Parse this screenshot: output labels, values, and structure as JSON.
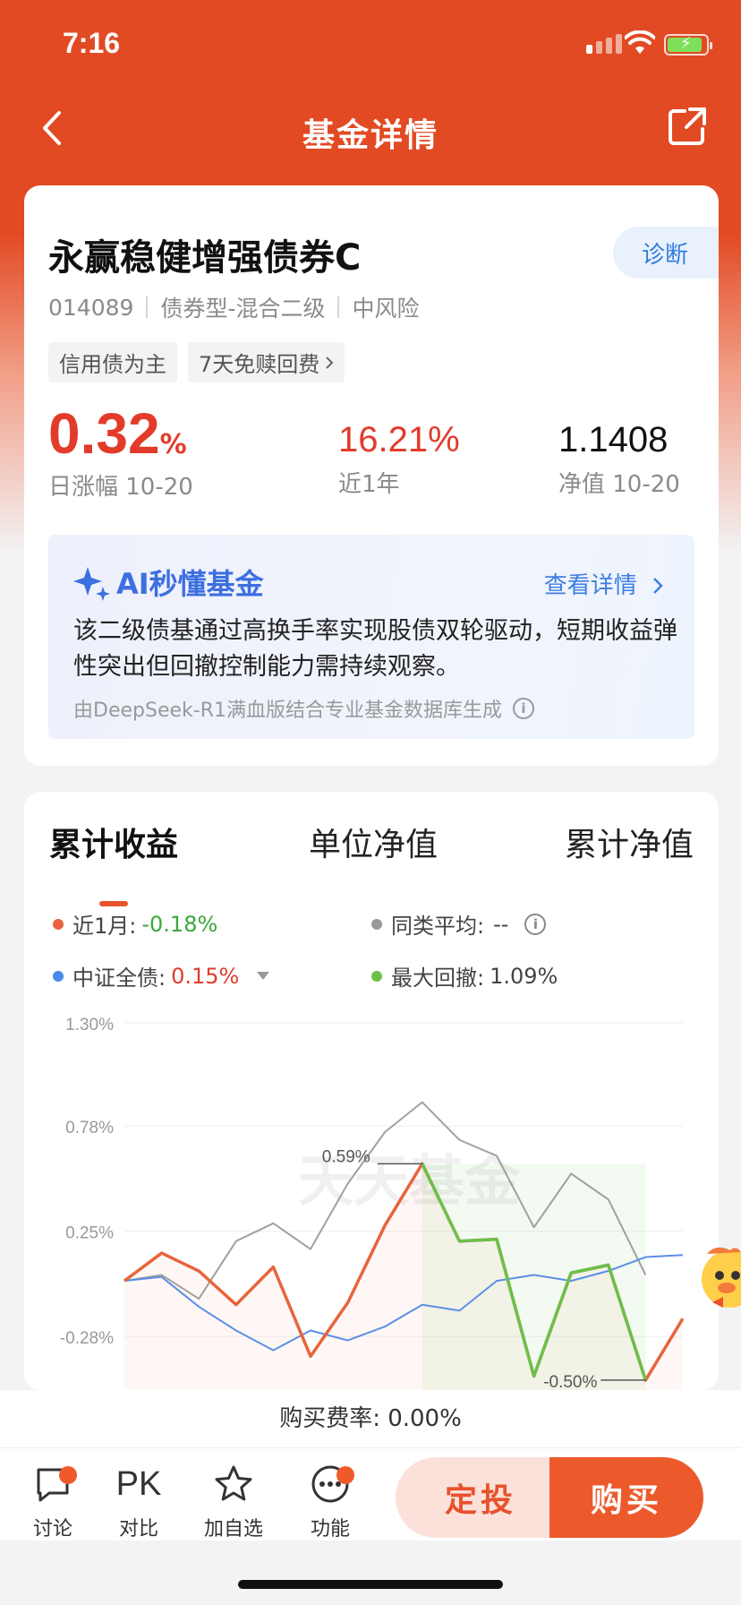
{
  "status": {
    "time": "7:16"
  },
  "nav": {
    "title": "基金详情"
  },
  "fund": {
    "name": "永赢稳健增强债券C",
    "diagnose": "诊断",
    "code": "014089",
    "type": "债券型-混合二级",
    "risk": "中风险",
    "tags": [
      "信用债为主",
      "7天免赎回费"
    ]
  },
  "metrics": {
    "daily_value": "0.32",
    "daily_unit": "%",
    "daily_label": "日涨幅 10-20",
    "year_value": "16.21%",
    "year_label": "近1年",
    "nav_value": "1.1408",
    "nav_label": "净值 10-20"
  },
  "ai": {
    "title": "AI秒懂基金",
    "more": "查看详情",
    "summary": "该二级债基通过高换手率实现股债双轮驱动，短期收益弹性突出但回撤控制能力需持续观察。",
    "footer": "由DeepSeek-R1满血版结合专业基金数据库生成"
  },
  "tabs": [
    "累计收益",
    "单位净值",
    "累计净值"
  ],
  "legend": {
    "month_label": "近1月:",
    "month_value": "-0.18%",
    "avg_label": "同类平均:",
    "avg_value": "--",
    "index_label": "中证全债:",
    "index_value": "0.15%",
    "drawdown_label": "最大回撤:",
    "drawdown_value": "1.09%"
  },
  "chart_data": {
    "type": "line",
    "y_ticks": [
      "1.30%",
      "0.78%",
      "0.25%",
      "-0.28%"
    ],
    "ylim": [
      -0.55,
      1.3
    ],
    "watermark": "天天基金",
    "annotations": [
      {
        "label": "0.59%",
        "value": 0.59
      },
      {
        "label": "-0.50%",
        "value": -0.5
      }
    ],
    "colors": {
      "fund": "#e8643c",
      "index": "#5b8fe6",
      "peer": "#a0a0a0",
      "drawdown": "#6cc04a"
    },
    "series": [
      {
        "name": "近1月",
        "values": [
          0.0,
          0.14,
          0.05,
          -0.12,
          0.07,
          -0.38,
          -0.11,
          0.28,
          0.59,
          0.2,
          0.21,
          -0.48,
          0.04,
          0.08,
          -0.5,
          -0.19
        ]
      },
      {
        "name": "中证全债",
        "values": [
          0.0,
          0.02,
          -0.13,
          -0.25,
          -0.35,
          -0.25,
          -0.3,
          -0.23,
          -0.12,
          -0.15,
          0.0,
          0.03,
          0.0,
          0.05,
          0.12,
          0.13
        ]
      },
      {
        "name": "同类平均",
        "values": [
          0.0,
          0.03,
          -0.09,
          0.2,
          0.29,
          0.16,
          0.49,
          0.75,
          0.9,
          0.71,
          0.63,
          0.27,
          0.54,
          0.41,
          0.03
        ]
      }
    ]
  },
  "fee": {
    "text": "购买费率: 0.00%"
  },
  "bottom": {
    "discuss": "讨论",
    "pk_icon": "PK",
    "compare": "对比",
    "watch": "加自选",
    "func": "功能",
    "auto_invest": "定投",
    "buy": "购买"
  }
}
